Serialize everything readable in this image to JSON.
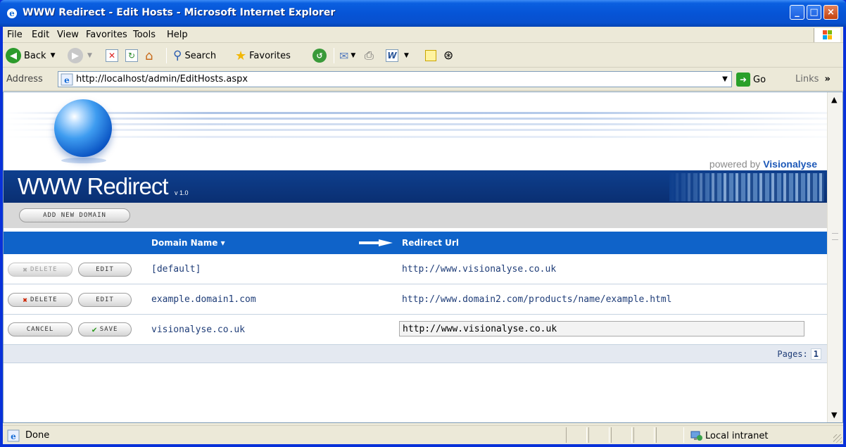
{
  "window": {
    "title": "WWW Redirect - Edit Hosts - Microsoft Internet Explorer",
    "minimize": "_",
    "maximize": "□",
    "close": "×"
  },
  "menu": {
    "items": [
      "File",
      "Edit",
      "View",
      "Favorites",
      "Tools",
      "Help"
    ]
  },
  "toolbar": {
    "back_label": "Back",
    "search_label": "Search",
    "favorites_label": "Favorites"
  },
  "address": {
    "label": "Address",
    "url": "http://localhost/admin/EditHosts.aspx",
    "go_label": "Go",
    "links_label": "Links",
    "links_chevron": "»"
  },
  "header": {
    "powered_prefix": "powered by ",
    "powered_brand": "Visionalyse",
    "brand": "WWW Redirect",
    "version": "v 1.0"
  },
  "actions": {
    "add_new_domain": "add new domain"
  },
  "grid": {
    "col_domain": "Domain Name",
    "col_domain_sort": "▾",
    "col_redirect": "Redirect Url",
    "rows": [
      {
        "delete_label": "delete",
        "edit_label": "edit",
        "domain": "[default]",
        "redirect": "http://www.visionalyse.co.uk"
      },
      {
        "delete_label": "delete",
        "edit_label": "edit",
        "domain": "example.domain1.com",
        "redirect": "http://www.domain2.com/products/name/example.html"
      },
      {
        "cancel_label": "cancel",
        "save_label": "save",
        "domain": "visionalyse.co.uk",
        "redirect_value": "http://www.visionalyse.co.uk"
      }
    ],
    "pages_label": "Pages:",
    "current_page": "1"
  },
  "status": {
    "text": "Done",
    "zone": "Local intranet"
  },
  "colors": {
    "titlebar": "#0654d6",
    "grid_header": "#0f63c9",
    "brand_bar": "#0e3f8e",
    "link_text": "#1f3d78"
  }
}
